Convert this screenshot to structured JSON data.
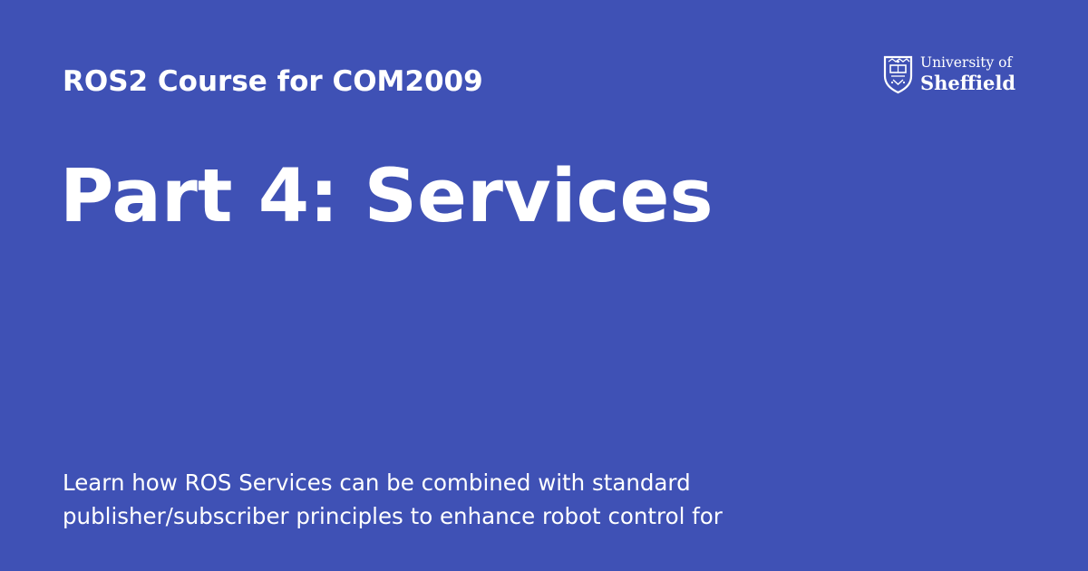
{
  "course": {
    "title": "ROS2 Course for COM2009"
  },
  "page": {
    "title": "Part 4: Services"
  },
  "description": {
    "line1": "Learn how ROS Services can be combined with standard",
    "line2": "publisher/subscriber principles to enhance robot control for"
  },
  "logo": {
    "line1": "University of",
    "line2": "Sheffield",
    "icon": "crest-icon"
  },
  "colors": {
    "background": "#3f51b5",
    "text": "#ffffff"
  }
}
